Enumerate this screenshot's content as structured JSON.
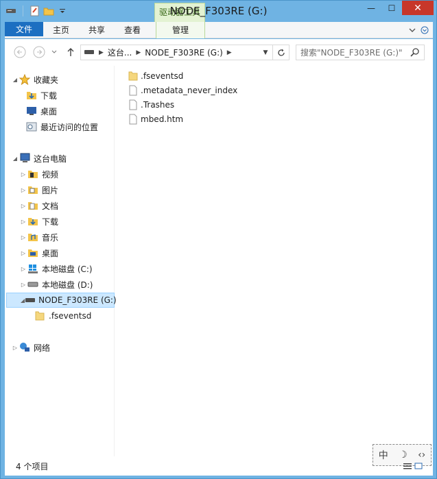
{
  "window": {
    "title": "NODE_F303RE (G:)",
    "context_tab": "驱动器工具",
    "minimize": "—",
    "maximize": "☐",
    "close": "✕"
  },
  "ribbon": {
    "tabs": [
      "文件",
      "主页",
      "共享",
      "查看"
    ],
    "manage_tab": "管理"
  },
  "address": {
    "crumbs": [
      "这台...",
      "NODE_F303RE (G:)"
    ],
    "search_placeholder": "搜索\"NODE_F303RE (G:)\""
  },
  "nav": {
    "favorites": {
      "label": "收藏夹",
      "items": [
        "下载",
        "桌面",
        "最近访问的位置"
      ]
    },
    "this_pc": {
      "label": "这台电脑",
      "items": [
        "视频",
        "图片",
        "文档",
        "下载",
        "音乐",
        "桌面",
        "本地磁盘 (C:)",
        "本地磁盘 (D:)",
        "NODE_F303RE (G:)"
      ],
      "sub_item": ".fseventsd"
    },
    "network": "网络"
  },
  "files": [
    ".fseventsd",
    ".metadata_never_index",
    ".Trashes",
    "mbed.htm"
  ],
  "status": {
    "count": "4 个项目"
  },
  "ime": {
    "mode": "中"
  },
  "colors": {
    "file_tab": "#1c6fc1",
    "selected": "#cce8ff",
    "close": "#c7372a",
    "context_tab": "#e3f2d2"
  }
}
